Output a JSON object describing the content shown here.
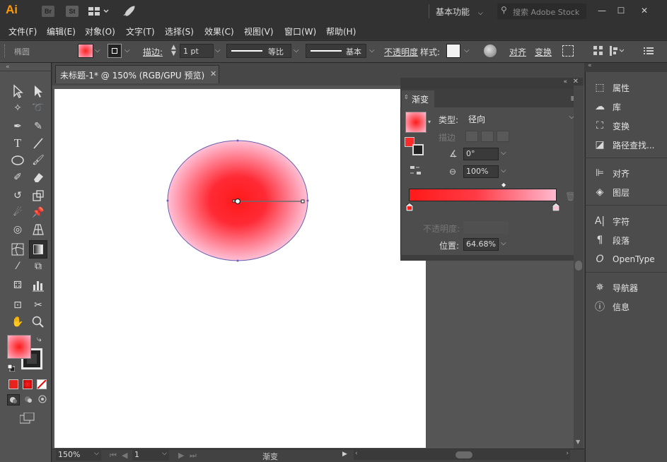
{
  "app": {
    "logo": "Ai",
    "icons": [
      "br-icon",
      "st-icon",
      "layout-icon",
      "rocket-icon"
    ],
    "bridge_label": "Br",
    "stock_label": "St",
    "workspace": "基本功能",
    "search_placeholder": "搜索 Adobe Stock",
    "window_controls": [
      "—",
      "☐",
      "✕"
    ]
  },
  "menu": [
    "文件(F)",
    "编辑(E)",
    "对象(O)",
    "文字(T)",
    "选择(S)",
    "效果(C)",
    "视图(V)",
    "窗口(W)",
    "帮助(H)"
  ],
  "control": {
    "object_type": "椭圆",
    "stroke_label": "描边",
    "stroke_weight": "1 pt",
    "stroke_profile": "等比",
    "brush": "基本",
    "opacity_label": "不透明度",
    "style_label": "样式",
    "align_label": "对齐",
    "transform_label": "变换"
  },
  "document": {
    "tab_title": "未标题-1* @ 150% (RGB/GPU 预览)",
    "close": "✕"
  },
  "gradient_panel": {
    "title": "渐变",
    "type_label": "类型",
    "type_value": "径向",
    "stroke_label": "描边",
    "angle_value": "0°",
    "aspect_value": "100%",
    "opacity_label": "不透明度",
    "location_label": "位置",
    "location_value": "64.68%"
  },
  "right_dock": [
    {
      "icon": "properties-icon",
      "label": "属性"
    },
    {
      "icon": "libraries-icon",
      "label": "库"
    },
    {
      "icon": "transform-icon",
      "label": "变换"
    },
    {
      "icon": "pathfinder-icon",
      "label": "路径查找..."
    },
    {
      "icon": "align-icon",
      "label": "对齐"
    },
    {
      "icon": "layers-icon",
      "label": "图层"
    },
    {
      "icon": "character-icon",
      "label": "字符"
    },
    {
      "icon": "paragraph-icon",
      "label": "段落"
    },
    {
      "icon": "opentype-icon",
      "label": "OpenType"
    },
    {
      "icon": "navigator-icon",
      "label": "导航器"
    },
    {
      "icon": "info-icon",
      "label": "信息"
    }
  ],
  "status": {
    "zoom": "150%",
    "artboard_number": "1",
    "tool_name": "渐变"
  },
  "colors": {
    "gradient_start": "#ff1a1a",
    "gradient_end": "#ffc0d6",
    "accent": "#ff9a00"
  }
}
